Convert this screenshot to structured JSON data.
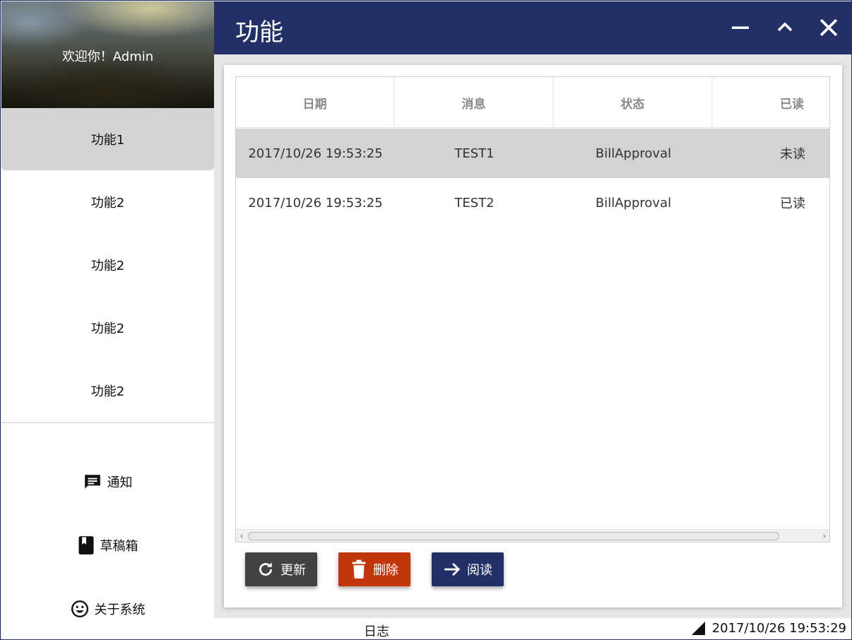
{
  "window": {
    "title": "功能"
  },
  "sidebar": {
    "welcome": "欢迎你！Admin",
    "nav_items": [
      {
        "label": "功能1",
        "active": true
      },
      {
        "label": "功能2",
        "active": false
      },
      {
        "label": "功能2",
        "active": false
      },
      {
        "label": "功能2",
        "active": false
      },
      {
        "label": "功能2",
        "active": false
      }
    ],
    "bottom_items": [
      {
        "label": "通知",
        "icon": "message-icon"
      },
      {
        "label": "草稿箱",
        "icon": "book-icon"
      },
      {
        "label": "关于系统",
        "icon": "smiley-icon"
      }
    ]
  },
  "table": {
    "columns": [
      "日期",
      "消息",
      "状态",
      "已读"
    ],
    "rows": [
      {
        "date": "2017/10/26 19:53:25",
        "message": "TEST1",
        "status": "BillApproval",
        "read": "未读",
        "selected": true
      },
      {
        "date": "2017/10/26 19:53:25",
        "message": "TEST2",
        "status": "BillApproval",
        "read": "已读",
        "selected": false
      }
    ]
  },
  "actions": {
    "refresh": {
      "label": "更新",
      "color": "#424242",
      "icon": "refresh-icon"
    },
    "delete": {
      "label": "删除",
      "color": "#c2360e",
      "icon": "trash-icon"
    },
    "read": {
      "label": "阅读",
      "color": "#233066",
      "icon": "arrow-right-icon"
    }
  },
  "statusbar": {
    "left": "日志",
    "datetime": "2017/10/26 19:53:29"
  },
  "colors": {
    "titlebar": "#233066",
    "selected_row": "#d3d3d3",
    "active_nav": "#d3d3d3"
  }
}
